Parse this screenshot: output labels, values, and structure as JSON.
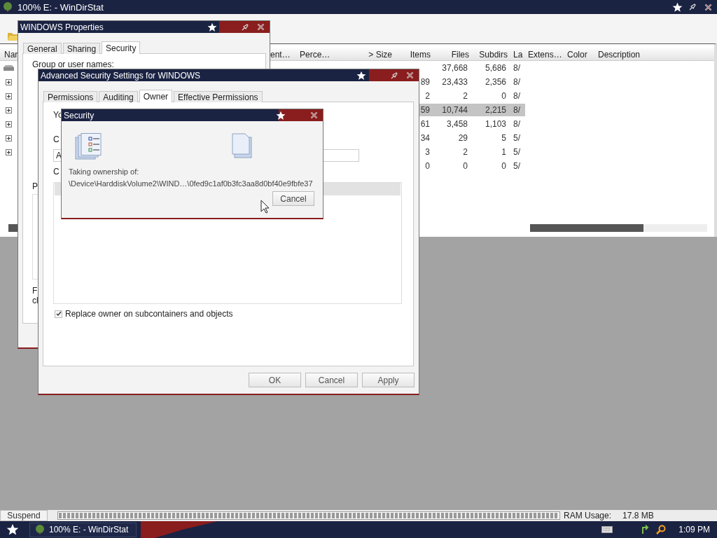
{
  "main_window": {
    "title": "100% E: - WinDirStat"
  },
  "list": {
    "columns": [
      "Nar",
      "ent…",
      "Perce…",
      "> Size",
      "Items",
      "Files",
      "Subdirs",
      "La",
      "Extens…",
      "Color",
      "Description"
    ],
    "rows": [
      {
        "kind": "drive",
        "files": "37,668",
        "subdirs": "5,686",
        "last": "8/",
        "selected": false
      },
      {
        "kind": "expander",
        "items": "89",
        "files": "23,433",
        "subdirs": "2,356",
        "last": "8/",
        "selected": false
      },
      {
        "kind": "expander",
        "items": "2",
        "files": "2",
        "subdirs": "0",
        "last": "8/",
        "selected": false
      },
      {
        "kind": "expander",
        "items": "59",
        "files": "10,744",
        "subdirs": "2,215",
        "last": "8/",
        "selected": true
      },
      {
        "kind": "expander",
        "items": "61",
        "files": "3,458",
        "subdirs": "1,103",
        "last": "8/",
        "selected": false
      },
      {
        "kind": "expander",
        "items": "34",
        "files": "29",
        "subdirs": "5",
        "last": "5/",
        "selected": false
      },
      {
        "kind": "expander",
        "items": "3",
        "files": "2",
        "subdirs": "1",
        "last": "5/",
        "selected": false
      },
      {
        "kind": "none",
        "items": "0",
        "files": "0",
        "subdirs": "0",
        "last": "5/",
        "selected": false
      }
    ]
  },
  "properties_window": {
    "title": "WINDOWS Properties",
    "tabs": [
      {
        "label": "General",
        "selected": false
      },
      {
        "label": "Sharing",
        "selected": false
      },
      {
        "label": "Security",
        "selected": true
      }
    ],
    "group_label": "Group or user names:",
    "permissions_label": "P",
    "note_lines": [
      "F",
      "cl"
    ]
  },
  "advanced_window": {
    "title": "Advanced Security Settings for WINDOWS",
    "tabs": [
      {
        "label": "Permissions",
        "selected": false
      },
      {
        "label": "Auditing",
        "selected": false
      },
      {
        "label": "Owner",
        "selected": true
      },
      {
        "label": "Effective Permissions",
        "selected": false
      }
    ],
    "intro_text": "Yo",
    "current_owner_label": "C",
    "current_owner_value": "A",
    "change_owner_label": "C",
    "replace_owner": {
      "label": "Replace owner on subcontainers and objects",
      "checked": true
    },
    "buttons": [
      "OK",
      "Cancel",
      "Apply"
    ]
  },
  "security_dialog": {
    "title": "Security",
    "message": "Taking ownership of:",
    "path": "\\Device\\HarddiskVolume2\\WIND…\\0fed9c1af0b3fc3aa8d0bf40e9fbfe37",
    "button": "Cancel"
  },
  "status_bar": {
    "button": "Suspend",
    "progress": {
      "level": 1
    },
    "ram_label": "RAM Usage:",
    "ram_value": "17.8 MB"
  },
  "taskbar": {
    "tasks": [
      {
        "label": "100% E: - WinDirStat",
        "selected": false
      }
    ],
    "clock": "1:09 PM"
  }
}
